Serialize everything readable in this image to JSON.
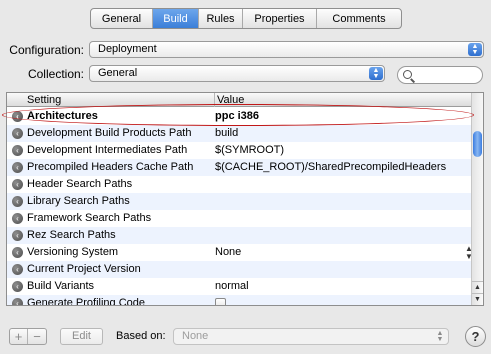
{
  "tabs": [
    "General",
    "Build",
    "Rules",
    "Properties",
    "Comments"
  ],
  "selected_tab": "Build",
  "configuration": {
    "label": "Configuration:",
    "value": "Deployment"
  },
  "collection": {
    "label": "Collection:",
    "value": "General"
  },
  "search": {
    "value": ""
  },
  "table": {
    "headers": {
      "setting": "Setting",
      "value": "Value"
    },
    "rows": [
      {
        "name": "Architectures",
        "value": "ppc i386"
      },
      {
        "name": "Development Build Products Path",
        "value": "build"
      },
      {
        "name": "Development Intermediates Path",
        "value": "$(SYMROOT)"
      },
      {
        "name": "Precompiled Headers Cache Path",
        "value": "$(CACHE_ROOT)/SharedPrecompiledHeaders"
      },
      {
        "name": "Header Search Paths",
        "value": ""
      },
      {
        "name": "Library Search Paths",
        "value": ""
      },
      {
        "name": "Framework Search Paths",
        "value": ""
      },
      {
        "name": "Rez Search Paths",
        "value": ""
      },
      {
        "name": "Versioning System",
        "value": "None"
      },
      {
        "name": "Current Project Version",
        "value": ""
      },
      {
        "name": "Build Variants",
        "value": "normal"
      },
      {
        "name": "Generate Profiling Code",
        "value": ""
      }
    ]
  },
  "bottom": {
    "add_label": "+",
    "remove_label": "−",
    "edit_label": "Edit",
    "based_on_label": "Based on:",
    "based_on_value": "None",
    "help_label": "?"
  },
  "colors": {
    "highlight_oval": "#c11818",
    "selected_tab": "#3b7fd8"
  }
}
